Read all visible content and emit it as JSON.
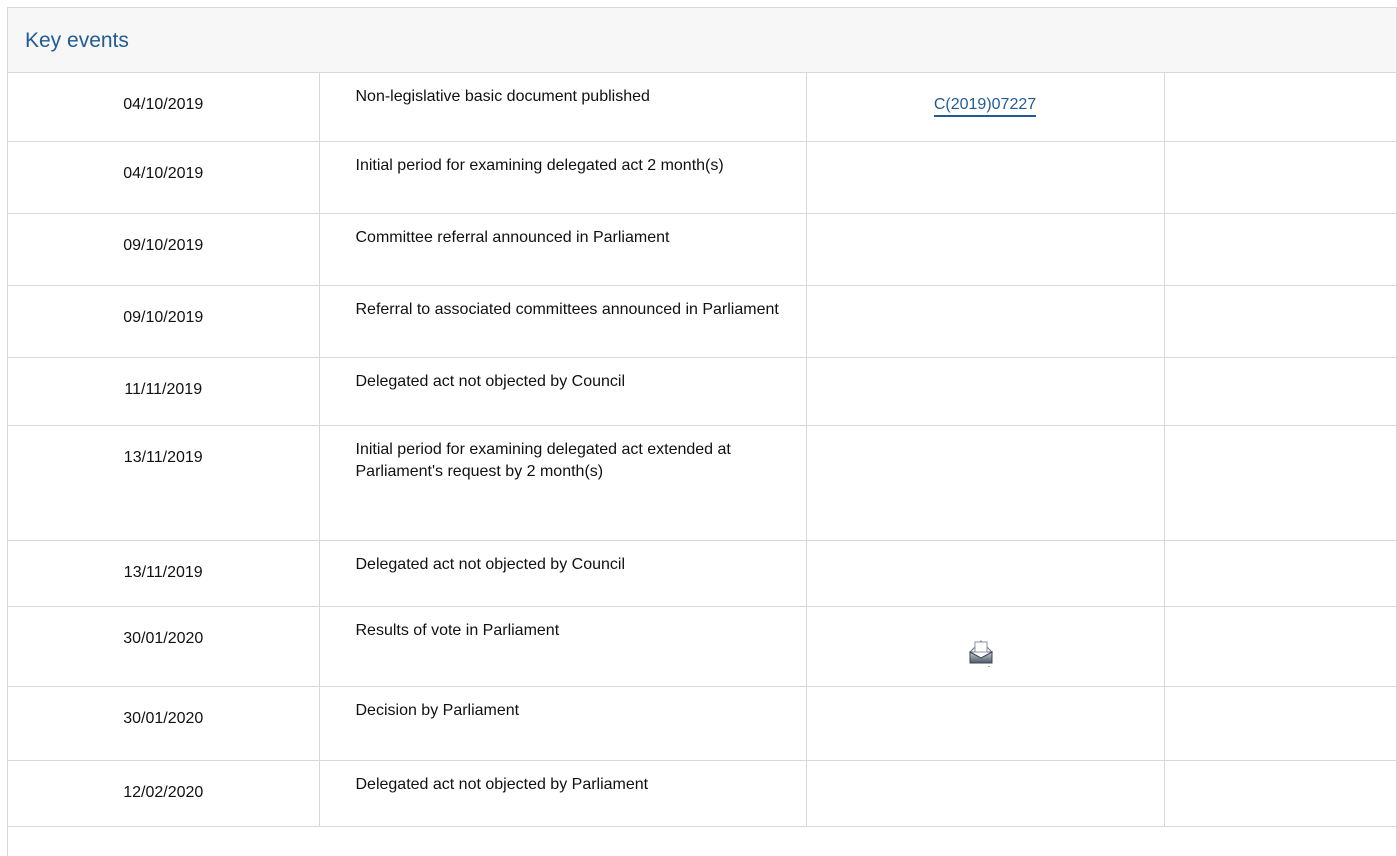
{
  "header": {
    "title": "Key events"
  },
  "events": [
    {
      "date": "04/10/2019",
      "description": "Non-legislative basic document published",
      "document": "C(2019)07227"
    },
    {
      "date": "04/10/2019",
      "description": "Initial period for examining delegated act 2 month(s)"
    },
    {
      "date": "09/10/2019",
      "description": "Committee referral announced in Parliament"
    },
    {
      "date": "09/10/2019",
      "description": "Referral to associated committees announced in Parliament"
    },
    {
      "date": "11/11/2019",
      "description": "Delegated act not objected by Council"
    },
    {
      "date": "13/11/2019",
      "description": "Initial period for examining delegated act extended at Parliament's request by 2 month(s)"
    },
    {
      "date": "13/11/2019",
      "description": "Delegated act not objected by Council"
    },
    {
      "date": "30/01/2020",
      "description": "Results of vote in Parliament",
      "icon": "ballot-box-icon"
    },
    {
      "date": "30/01/2020",
      "description": "Decision by Parliament"
    },
    {
      "date": "12/02/2020",
      "description": "Delegated act not objected by Parliament"
    }
  ],
  "colors": {
    "link": "#215c93",
    "header_background": "#f7f7f7",
    "border": "#d8d8d8"
  }
}
